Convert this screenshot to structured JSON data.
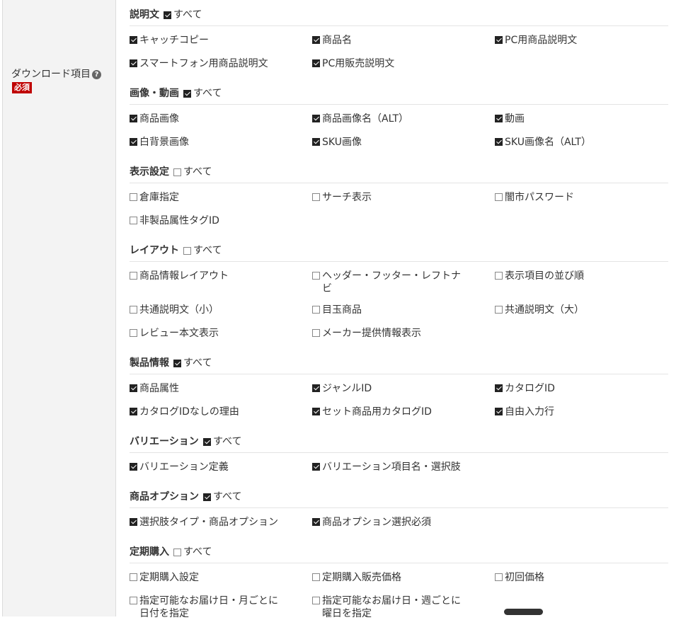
{
  "field": {
    "label": "ダウンロード項目",
    "help_icon": "question-circle-icon",
    "required_badge": "必須"
  },
  "all_label": "すべて",
  "sections": [
    {
      "title": "説明文",
      "all_checked": true,
      "items": [
        {
          "label": "キャッチコピー",
          "checked": true
        },
        {
          "label": "商品名",
          "checked": true
        },
        {
          "label": "PC用商品説明文",
          "checked": true
        },
        {
          "label": "スマートフォン用商品説明文",
          "checked": true
        },
        {
          "label": "PC用販売説明文",
          "checked": true
        }
      ]
    },
    {
      "title": "画像・動画",
      "all_checked": true,
      "items": [
        {
          "label": "商品画像",
          "checked": true
        },
        {
          "label": "商品画像名（ALT）",
          "checked": true
        },
        {
          "label": "動画",
          "checked": true
        },
        {
          "label": "白背景画像",
          "checked": true
        },
        {
          "label": "SKU画像",
          "checked": true
        },
        {
          "label": "SKU画像名（ALT）",
          "checked": true
        }
      ]
    },
    {
      "title": "表示設定",
      "all_checked": false,
      "items": [
        {
          "label": "倉庫指定",
          "checked": false
        },
        {
          "label": "サーチ表示",
          "checked": false
        },
        {
          "label": "闇市パスワード",
          "checked": false
        },
        {
          "label": "非製品属性タグID",
          "checked": false
        }
      ]
    },
    {
      "title": "レイアウト",
      "all_checked": false,
      "items": [
        {
          "label": "商品情報レイアウト",
          "checked": false
        },
        {
          "label": "ヘッダー・フッター・レフトナビ",
          "checked": false
        },
        {
          "label": "表示項目の並び順",
          "checked": false
        },
        {
          "label": "共通説明文（小）",
          "checked": false
        },
        {
          "label": "目玉商品",
          "checked": false
        },
        {
          "label": "共通説明文（大）",
          "checked": false
        },
        {
          "label": "レビュー本文表示",
          "checked": false
        },
        {
          "label": "メーカー提供情報表示",
          "checked": false
        }
      ]
    },
    {
      "title": "製品情報",
      "all_checked": true,
      "items": [
        {
          "label": "商品属性",
          "checked": true
        },
        {
          "label": "ジャンルID",
          "checked": true
        },
        {
          "label": "カタログID",
          "checked": true
        },
        {
          "label": "カタログIDなしの理由",
          "checked": true
        },
        {
          "label": "セット商品用カタログID",
          "checked": true
        },
        {
          "label": "自由入力行",
          "checked": true
        }
      ]
    },
    {
      "title": "バリエーション",
      "all_checked": true,
      "items": [
        {
          "label": "バリエーション定義",
          "checked": true
        },
        {
          "label": "バリエーション項目名・選択肢",
          "checked": true
        }
      ]
    },
    {
      "title": "商品オプション",
      "all_checked": true,
      "items": [
        {
          "label": "選択肢タイプ・商品オプション",
          "checked": true
        },
        {
          "label": "商品オプション選択必須",
          "checked": true
        }
      ]
    },
    {
      "title": "定期購入",
      "all_checked": false,
      "items": [
        {
          "label": "定期購入設定",
          "checked": false
        },
        {
          "label": "定期購入販売価格",
          "checked": false
        },
        {
          "label": "初回価格",
          "checked": false
        },
        {
          "label": "指定可能なお届け日・月ごとに日付を指定",
          "checked": false
        },
        {
          "label": "指定可能なお届け日・週ごとに曜日を指定",
          "checked": false
        }
      ]
    }
  ]
}
